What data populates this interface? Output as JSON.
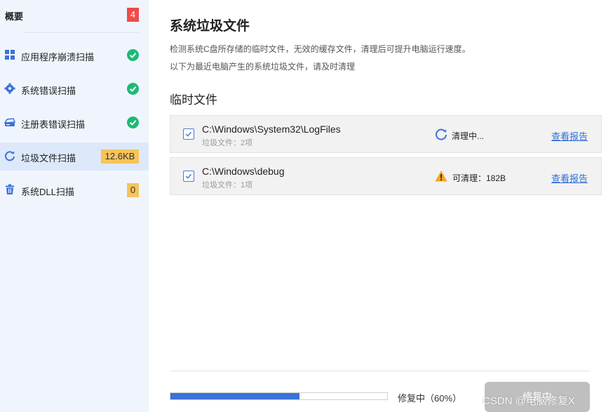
{
  "sidebar": {
    "header": {
      "title": "概要",
      "badge": "4"
    },
    "items": [
      {
        "label": "应用程序崩溃扫描",
        "icon": "grid-icon",
        "status": "done"
      },
      {
        "label": "系统错误扫描",
        "icon": "gear-icon",
        "status": "done"
      },
      {
        "label": "注册表错误扫描",
        "icon": "drive-icon",
        "status": "done"
      },
      {
        "label": "垃圾文件扫描",
        "icon": "refresh-icon",
        "value": "12.6KB",
        "active": true
      },
      {
        "label": "系统DLL扫描",
        "icon": "trash-icon",
        "value": "0"
      }
    ]
  },
  "main": {
    "title": "系统垃圾文件",
    "desc1": "检测系统C盘所存储的临时文件，无效的缓存文件，清理后可提升电脑运行速度。",
    "desc2": "以下为最近电脑产生的系统垃圾文件，请及时清理",
    "section_title": "临时文件",
    "rows": [
      {
        "path": "C:\\Windows\\System32\\LogFiles",
        "sub": "垃圾文件：2项",
        "status": "清理中...",
        "status_icon": "spinner-icon",
        "link": "查看报告",
        "checked": true
      },
      {
        "path": "C:\\Windows\\debug",
        "sub": "垃圾文件：1项",
        "status": "可清理：182B",
        "status_icon": "warning-icon",
        "link": "查看报告",
        "checked": true
      }
    ]
  },
  "footer": {
    "progress": 0.6,
    "progress_text": "修复中（60%）",
    "button_label": "修复中",
    "watermark": "CSDN @电脑修复X"
  },
  "colors": {
    "accent": "#3b72d9",
    "success": "#1fb977",
    "danger": "#f04b4b",
    "warning": "#f7a51c",
    "value_badge": "#f7c35a"
  }
}
